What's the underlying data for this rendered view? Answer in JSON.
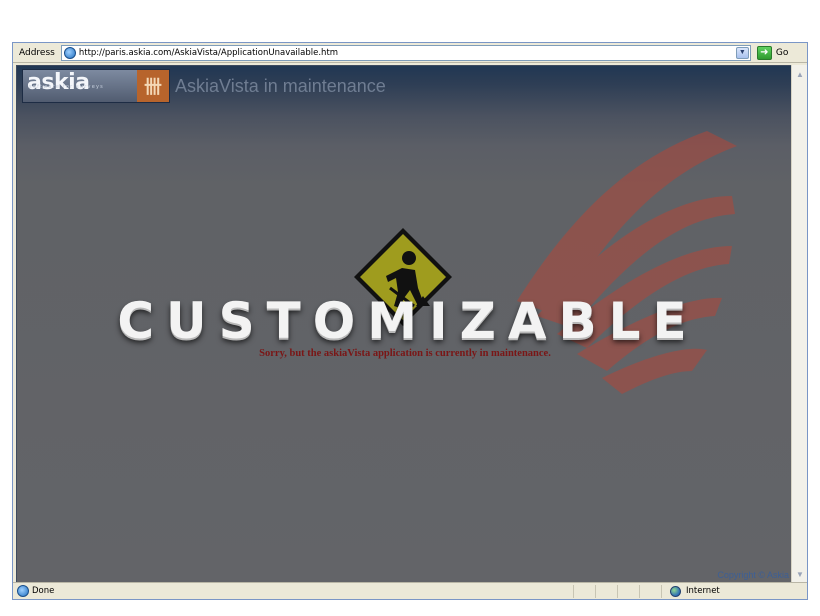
{
  "browser": {
    "address_label": "Address",
    "url": "http://paris.askia.com/AskiaVista/ApplicationUnavailable.htm",
    "go_label": "Go"
  },
  "page": {
    "logo_text": "askia",
    "logo_subtext": "software for surveys",
    "logo_mark": "卌",
    "heading": "AskiaVista in maintenance",
    "watermark": "CUSTOMIZABLE",
    "message": "Sorry, but the askiaVista application is currently in maintenance.",
    "copyright": "Copyright © Askia"
  },
  "status": {
    "text": "Done",
    "zone": "Internet"
  },
  "icons": {
    "page_icon": "ie-page-icon",
    "go": "go-arrow-icon",
    "dropdown": "chevron-down-icon",
    "sign": "construction-sign-icon",
    "zone": "globe-icon"
  },
  "colors": {
    "message": "#7a1616",
    "sign_fill": "#9f9c1e",
    "logo_orange": "#b7642c",
    "copyright": "#3d5f95"
  }
}
